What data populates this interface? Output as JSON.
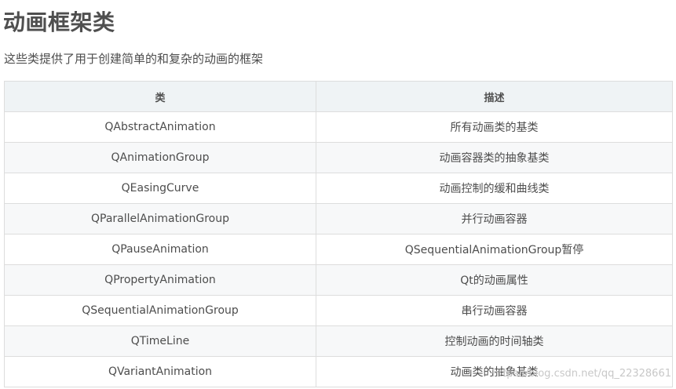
{
  "heading": "动画框架类",
  "intro": "这些类提供了用于创建简单的和复杂的动画的框架",
  "table": {
    "headers": [
      "类",
      "描述"
    ],
    "rows": [
      {
        "cls": "QAbstractAnimation",
        "desc": "所有动画类的基类"
      },
      {
        "cls": "QAnimationGroup",
        "desc": "动画容器类的抽象基类"
      },
      {
        "cls": "QEasingCurve",
        "desc": "动画控制的缓和曲线类"
      },
      {
        "cls": "QParallelAnimationGroup",
        "desc": "并行动画容器"
      },
      {
        "cls": "QPauseAnimation",
        "desc": "QSequentialAnimationGroup暂停"
      },
      {
        "cls": "QPropertyAnimation",
        "desc": "Qt的动画属性"
      },
      {
        "cls": "QSequentialAnimationGroup",
        "desc": "串行动画容器"
      },
      {
        "cls": "QTimeLine",
        "desc": "控制动画的时间轴类"
      },
      {
        "cls": "QVariantAnimation",
        "desc": "动画类的抽象基类"
      }
    ]
  },
  "watermark": "https://blog.csdn.net/qq_22328661"
}
